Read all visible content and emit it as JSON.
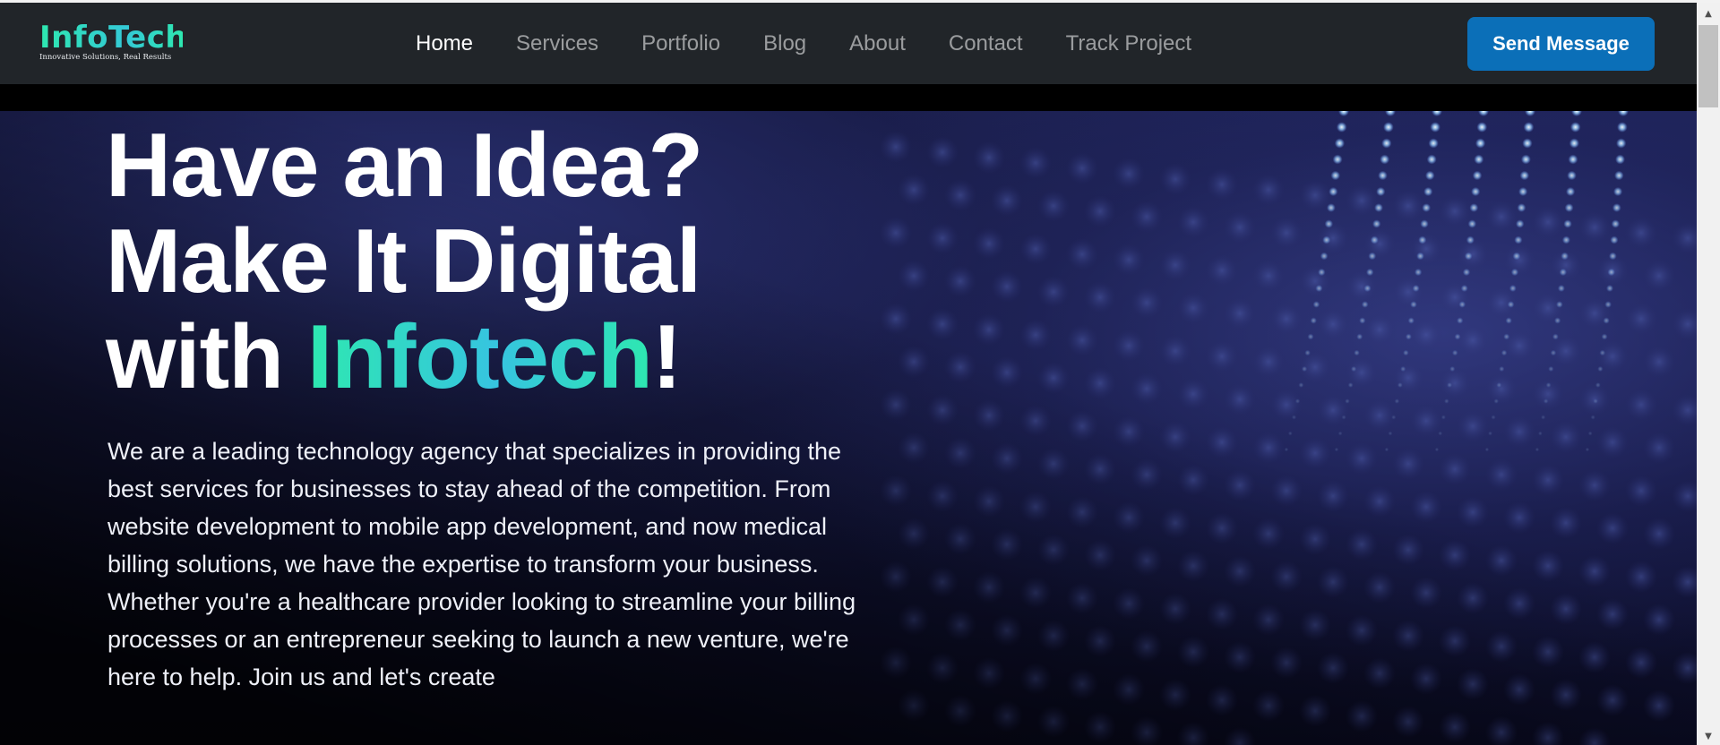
{
  "brand": {
    "name": "InfoTech",
    "tagline": "Innovative Solutions, Real Results"
  },
  "nav": {
    "links": [
      {
        "label": "Home",
        "active": true
      },
      {
        "label": "Services",
        "active": false
      },
      {
        "label": "Portfolio",
        "active": false
      },
      {
        "label": "Blog",
        "active": false
      },
      {
        "label": "About",
        "active": false
      },
      {
        "label": "Contact",
        "active": false
      },
      {
        "label": "Track Project",
        "active": false
      }
    ],
    "cta_label": "Send Message"
  },
  "hero": {
    "title_line1": "Have an Idea?",
    "title_line2": "Make It Digital",
    "title_line3_prefix": "with ",
    "title_line3_accent": "Infotech",
    "title_line3_suffix": "!",
    "description": "We are a leading technology agency that specializes in providing the best services for businesses to stay ahead of the competition. From website development to mobile app development, and now medical billing solutions, we have the expertise to transform your business. Whether you're a healthcare provider looking to streamline your billing processes or an entrepreneur seeking to launch a new venture, we're here to help. Join us and let's create"
  },
  "colors": {
    "navbar": "#212529",
    "cta": "#0b6fb8",
    "accent_green": "#2ee8b0",
    "accent_cyan": "#36c4e0",
    "hero_navy": "#1c2155"
  },
  "icons": {
    "scroll_up": "scroll-up-arrow-icon",
    "scroll_down": "scroll-down-arrow-icon"
  }
}
